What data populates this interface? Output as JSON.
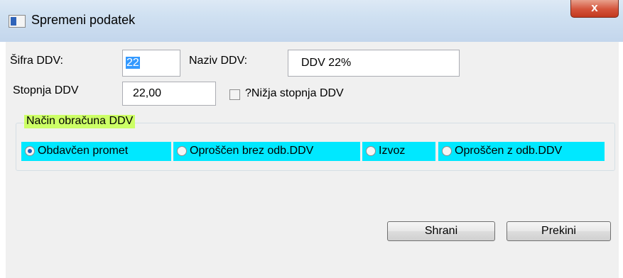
{
  "window": {
    "title": "Spremeni podatek",
    "close_label": "x"
  },
  "form": {
    "sifra_label": "Šifra DDV:",
    "sifra_value": "22",
    "naziv_label": "Naziv DDV:",
    "naziv_value": "DDV 22%",
    "stopnja_label": "Stopnja DDV",
    "stopnja_value": "22,00",
    "nizja_label": "?Nižja stopnja DDV",
    "nizja_checked": false
  },
  "group": {
    "title": "Način obračuna DDV",
    "options": [
      {
        "label": "Obdavčen promet",
        "checked": true
      },
      {
        "label": "Oproščen brez odb.DDV",
        "checked": false
      },
      {
        "label": "Izvoz",
        "checked": false
      },
      {
        "label": "Oproščen z odb.DDV",
        "checked": false
      }
    ]
  },
  "buttons": {
    "save": "Shrani",
    "cancel": "Prekini"
  },
  "colors": {
    "group_title_bg": "#ccff66",
    "radio_strip_bg": "#00e8ff",
    "selection": "#3399ff"
  }
}
